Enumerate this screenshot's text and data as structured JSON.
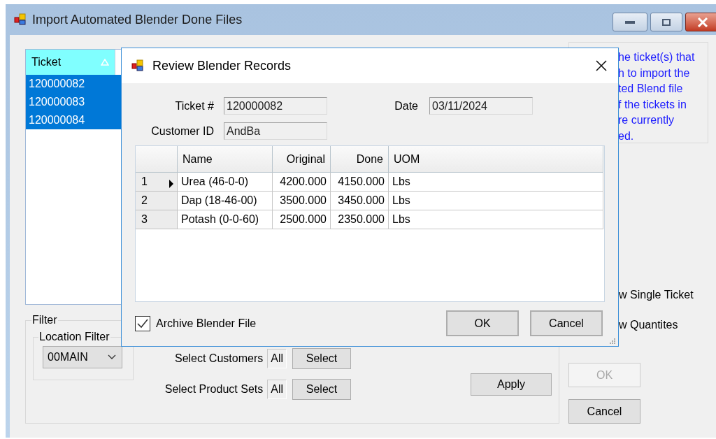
{
  "window": {
    "title": "Import Automated Blender Done Files"
  },
  "ticket_list": {
    "column": "Ticket",
    "rows": [
      {
        "ticket": "120000082",
        "selected": true
      },
      {
        "ticket": "120000083",
        "selected": true
      },
      {
        "ticket": "120000084",
        "selected": true
      }
    ]
  },
  "info_text": [
    "he ticket(s) that",
    "h to import the",
    "ted Blend file",
    "f the tickets in",
    "re currently",
    "ed."
  ],
  "options": [
    "w Single Ticket",
    "w Quantites"
  ],
  "filter": {
    "title": "Filter",
    "location_filter": {
      "title": "Location Filter",
      "value": "00MAIN"
    },
    "selectors": [
      {
        "label": "Select Customers",
        "value": "All",
        "button": "Select"
      },
      {
        "label": "Select Product Sets",
        "value": "All",
        "button": "Select"
      }
    ],
    "apply": "Apply"
  },
  "buttons": [
    {
      "label": "OK",
      "disabled": true
    },
    {
      "label": "Cancel",
      "disabled": false
    }
  ],
  "dialog": {
    "title": "Review Blender Records",
    "fields": [
      {
        "label": "Ticket #",
        "value": "120000082"
      },
      {
        "label": "Date",
        "value": "03/11/2024"
      },
      {
        "label": "Customer ID",
        "value": "AndBa"
      }
    ],
    "grid": {
      "columns": [
        "Name",
        "Original",
        "Done",
        "UOM"
      ],
      "rows": [
        {
          "number": "1",
          "current": true,
          "cells": [
            "Urea (46-0-0)",
            "4200.000",
            "4150.000",
            "Lbs"
          ]
        },
        {
          "number": "2",
          "current": false,
          "cells": [
            "Dap (18-46-00)",
            "3500.000",
            "3450.000",
            "Lbs"
          ]
        },
        {
          "number": "3",
          "current": false,
          "cells": [
            "Potash (0-0-60)",
            "2500.000",
            "2350.000",
            "Lbs"
          ]
        }
      ]
    },
    "archive": {
      "label": "Archive Blender File",
      "checked": true
    },
    "buttons": [
      "OK",
      "Cancel"
    ]
  }
}
